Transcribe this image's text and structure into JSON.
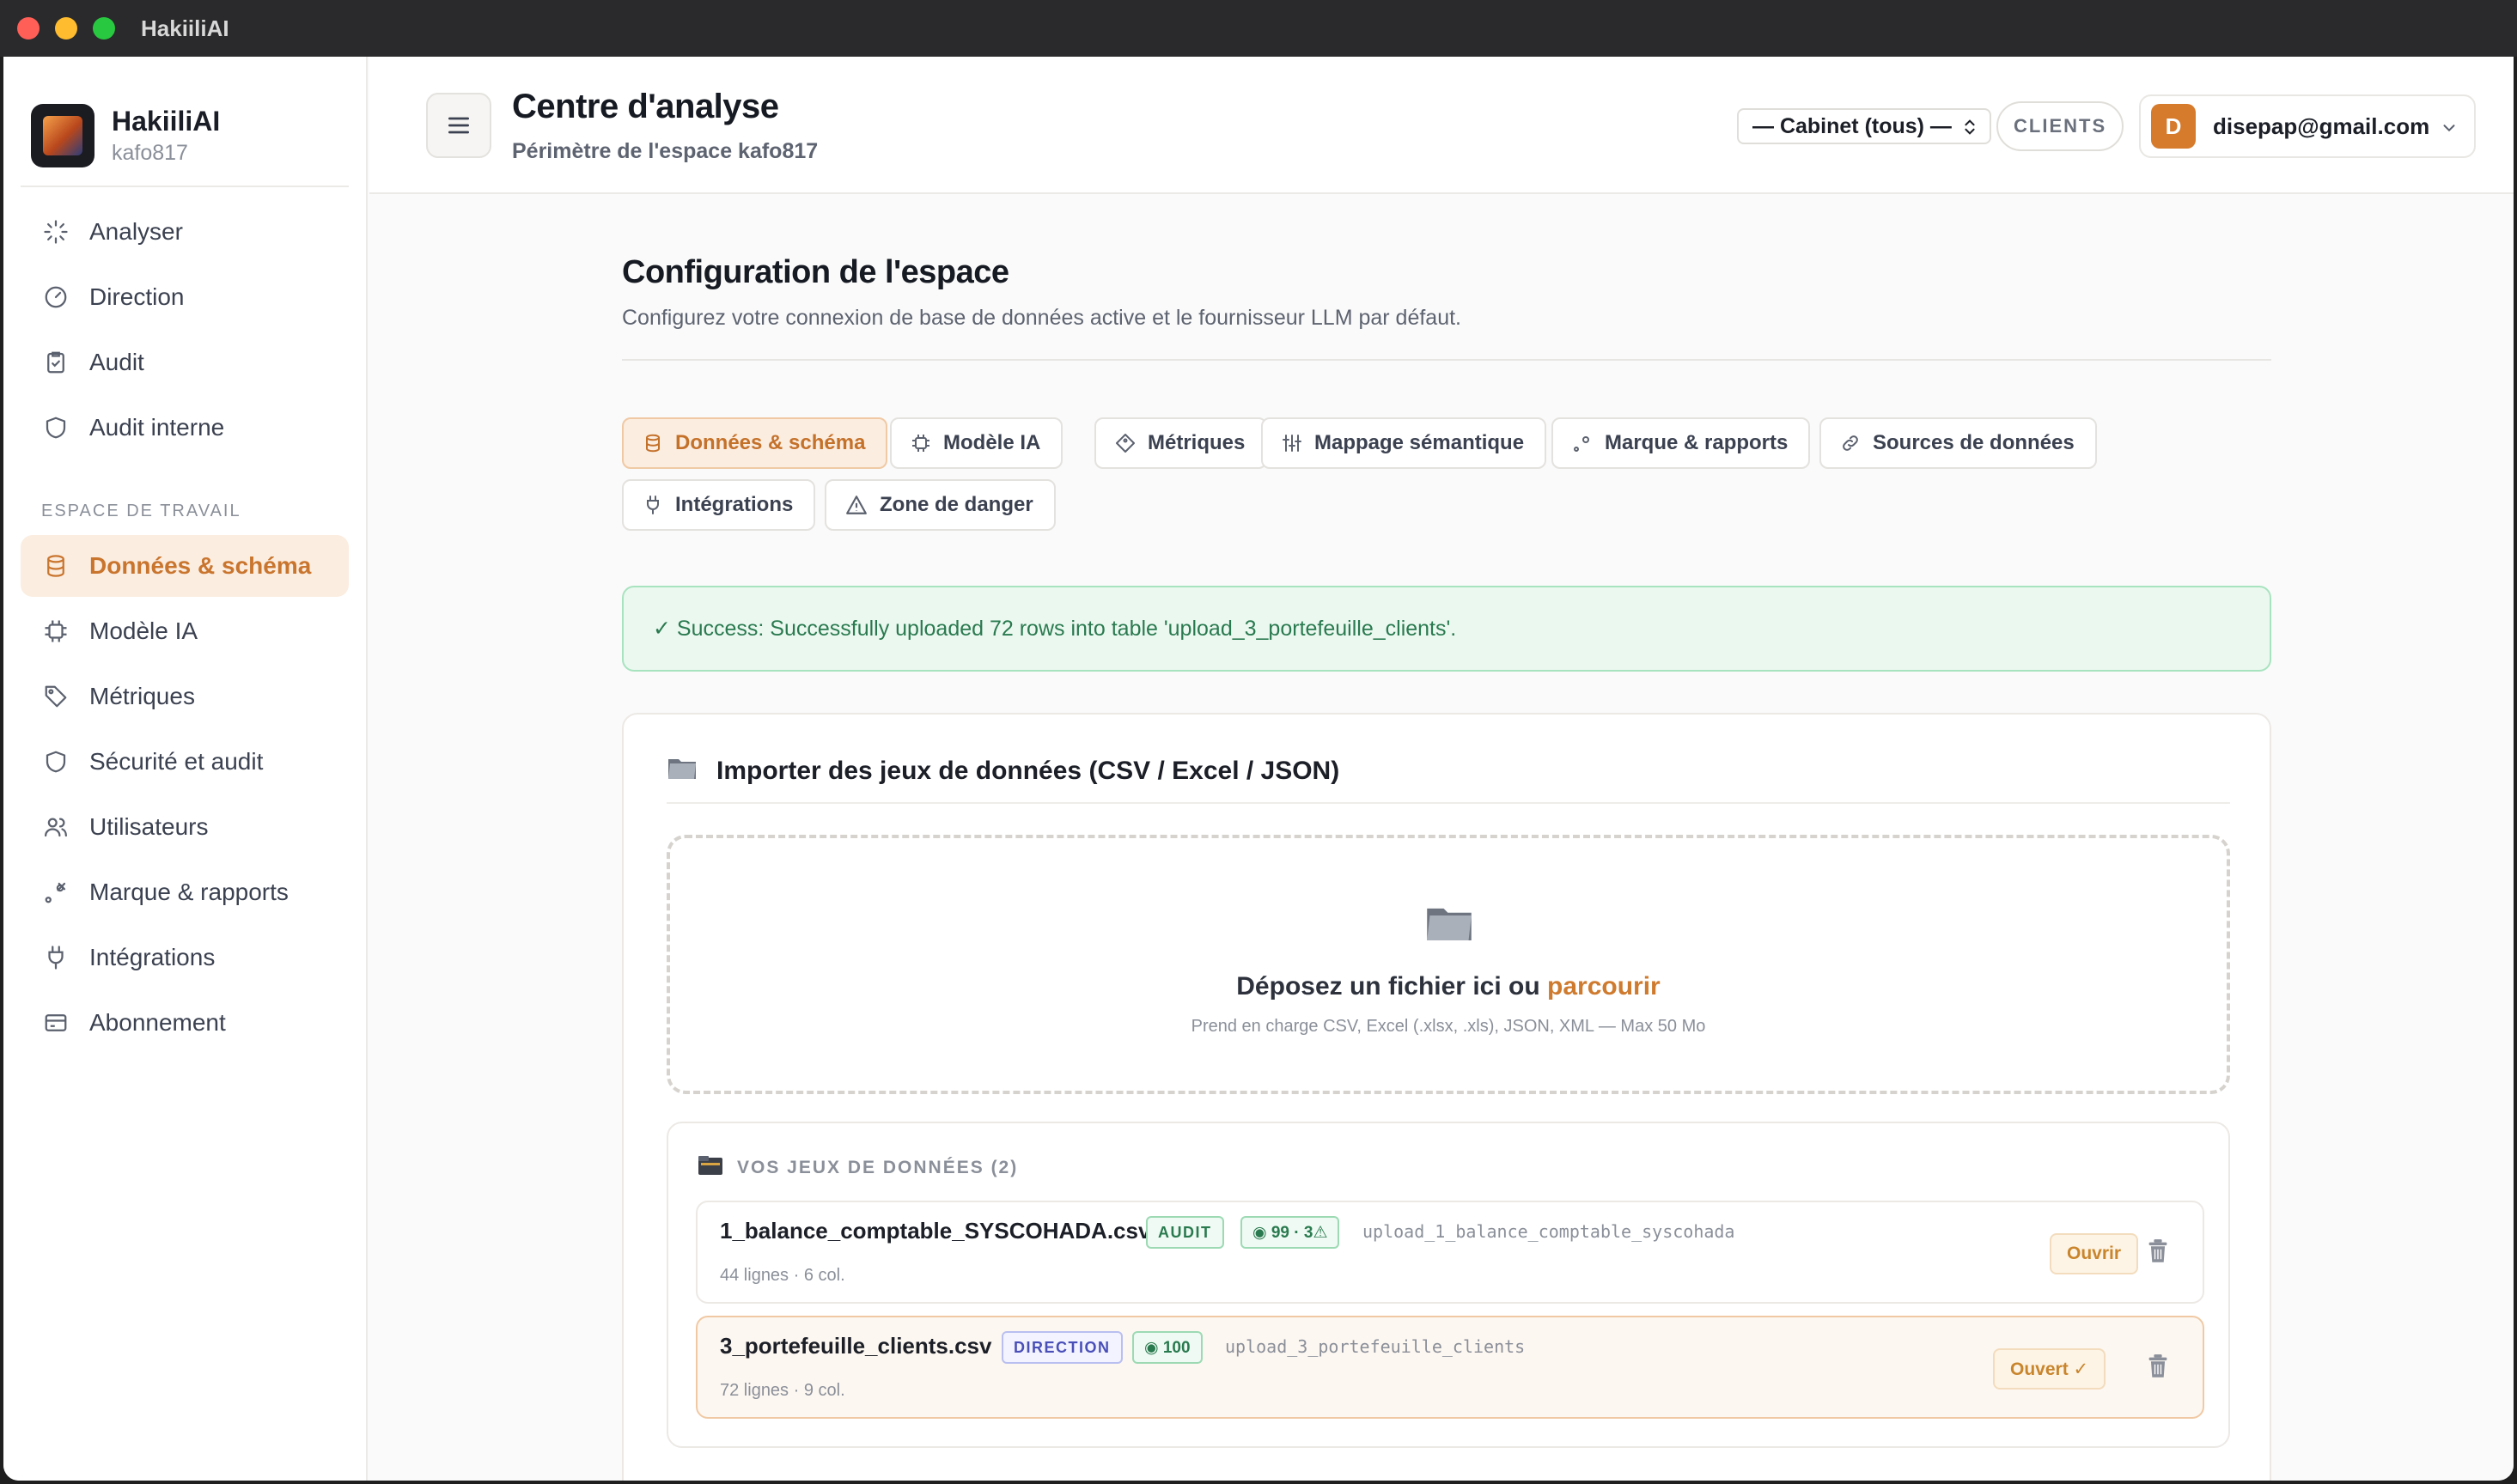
{
  "window": {
    "title": "HakiiliAI"
  },
  "brand": {
    "name": "HakiiliAI",
    "workspace": "kafo817"
  },
  "sidebar": {
    "items_top": [
      {
        "label": "Analyser",
        "icon": "sparkle-icon"
      },
      {
        "label": "Direction",
        "icon": "gauge-icon"
      },
      {
        "label": "Audit",
        "icon": "clipboard-icon"
      },
      {
        "label": "Audit interne",
        "icon": "shield-icon"
      }
    ],
    "section_label": "ESPACE DE TRAVAIL",
    "items_workspace": [
      {
        "label": "Données & schéma",
        "icon": "database-icon",
        "active": true
      },
      {
        "label": "Modèle IA",
        "icon": "chip-icon"
      },
      {
        "label": "Métriques",
        "icon": "tag-icon"
      },
      {
        "label": "Sécurité et audit",
        "icon": "shield-icon"
      },
      {
        "label": "Utilisateurs",
        "icon": "users-icon"
      },
      {
        "label": "Marque & rapports",
        "icon": "brush-icon"
      },
      {
        "label": "Intégrations",
        "icon": "plug-icon"
      },
      {
        "label": "Abonnement",
        "icon": "card-icon"
      }
    ]
  },
  "header": {
    "title": "Centre d'analyse",
    "subtitle": "Périmètre de l'espace kafo817",
    "cabinet_select": "— Cabinet (tous) —",
    "clients_button": "CLIENTS",
    "user_initial": "D",
    "user_email": "disepap@gmail.com"
  },
  "config": {
    "title": "Configuration de l'espace",
    "subtitle": "Configurez votre connexion de base de données active et le fournisseur LLM par défaut.",
    "tabs": [
      {
        "label": "Données & schéma",
        "icon": "database-icon",
        "active": true
      },
      {
        "label": "Modèle IA",
        "icon": "chip-icon"
      },
      {
        "label": "Métriques",
        "icon": "tag-icon"
      },
      {
        "label": "Mappage sémantique",
        "icon": "sliders-icon"
      },
      {
        "label": "Marque & rapports",
        "icon": "brush-icon"
      },
      {
        "label": "Sources de données",
        "icon": "link-icon"
      },
      {
        "label": "Intégrations",
        "icon": "plug-icon"
      },
      {
        "label": "Zone de danger",
        "icon": "warning-icon"
      }
    ],
    "alert": "✓ Success: Successfully uploaded 72 rows into table 'upload_3_portefeuille_clients'."
  },
  "import": {
    "title": "Importer des jeux de données (CSV / Excel / JSON)",
    "drop_text": "Déposez un fichier ici ou",
    "drop_link": "parcourir",
    "drop_hint": "Prend en charge CSV, Excel (.xlsx, .xls), JSON, XML — Max 50 Mo",
    "datasets_label": "VOS JEUX DE DONNÉES (2)",
    "datasets": [
      {
        "name": "1_balance_comptable_SYSCOHADA.csv",
        "tag": "AUDIT",
        "score": "◉ 99 · 3⚠",
        "table": "upload_1_balance_comptable_syscohada",
        "meta": "44 lignes · 6 col.",
        "action": "Ouvrir"
      },
      {
        "name": "3_portefeuille_clients.csv",
        "tag": "DIRECTION",
        "score": "◉ 100",
        "table": "upload_3_portefeuille_clients",
        "meta": "72 lignes · 9 col.",
        "action": "Ouvert ✓"
      }
    ]
  }
}
